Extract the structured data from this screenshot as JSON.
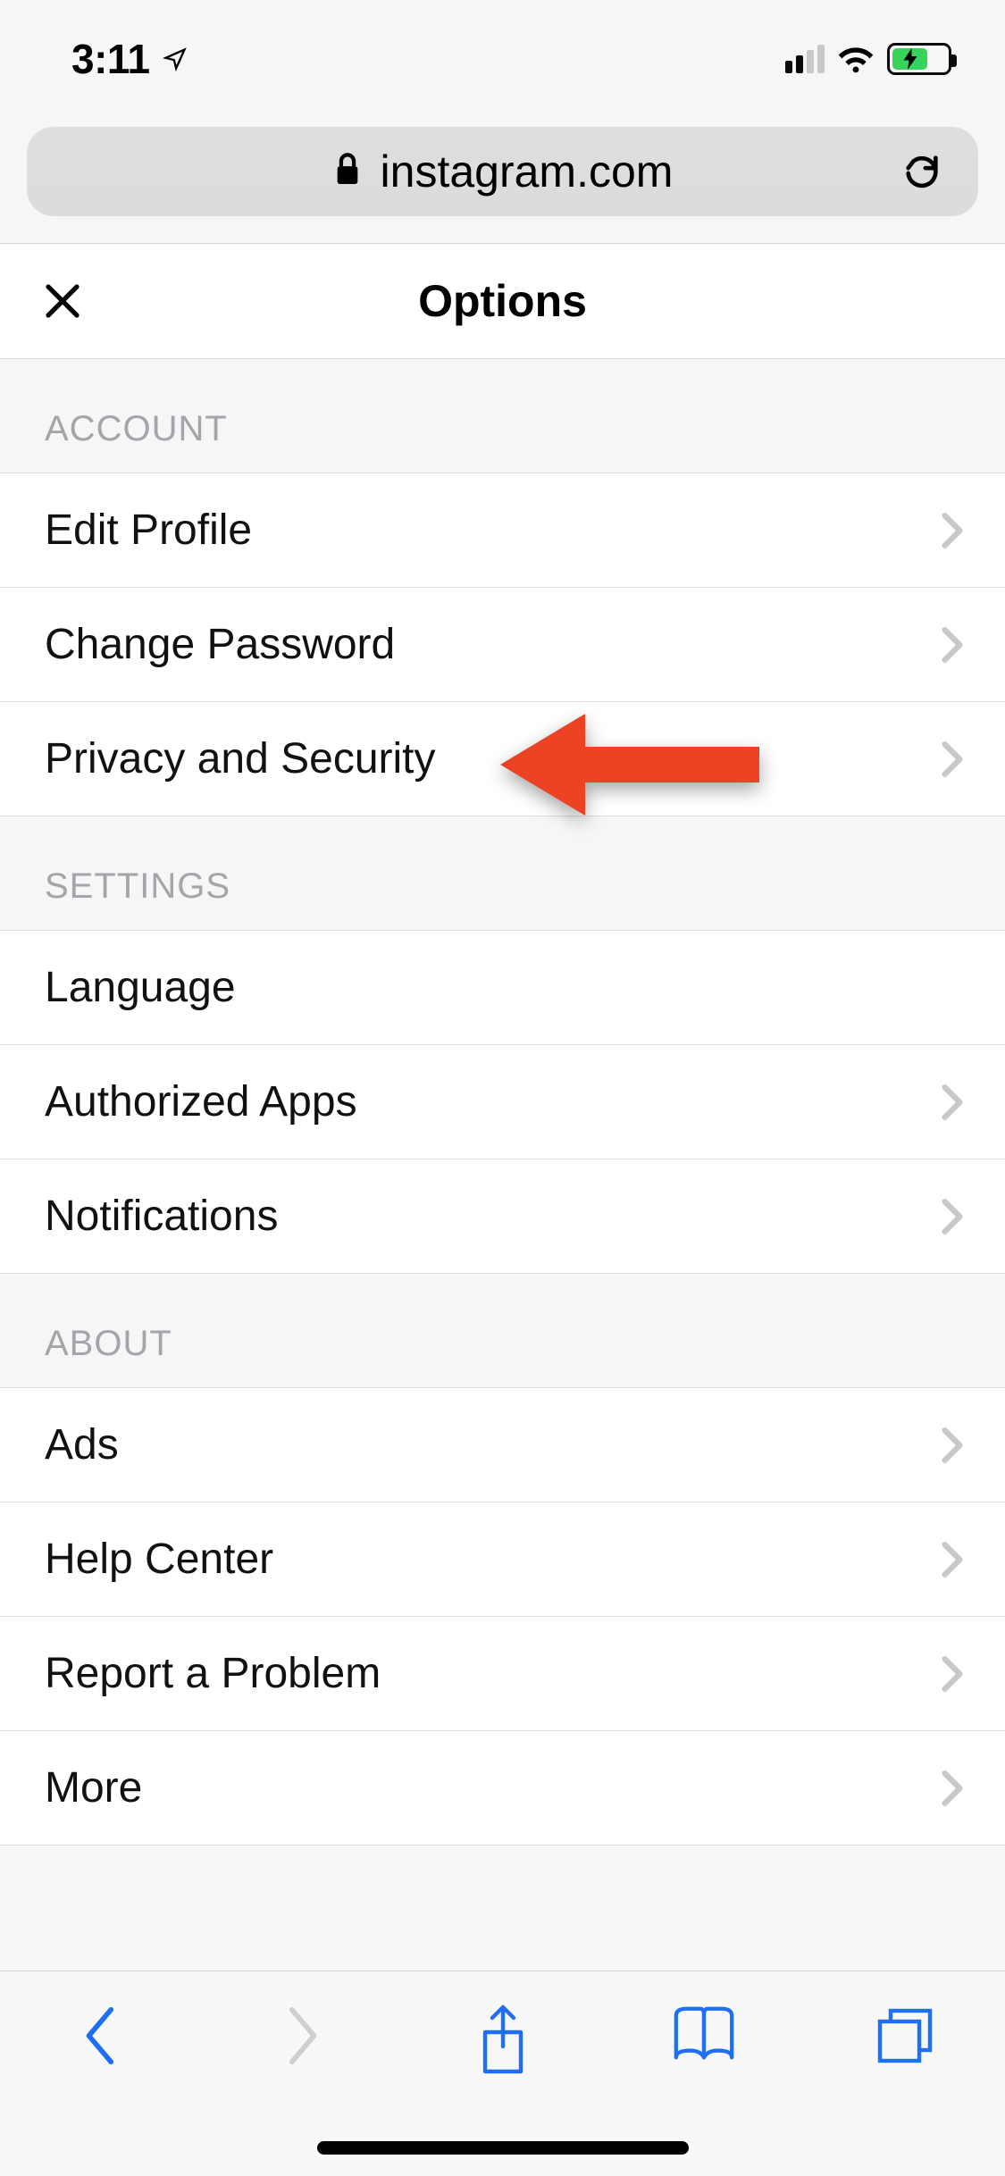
{
  "status": {
    "time": "3:11"
  },
  "address": {
    "domain": "instagram.com"
  },
  "header": {
    "title": "Options"
  },
  "sections": {
    "account": {
      "title": "Account",
      "items": {
        "edit_profile": "Edit Profile",
        "change_password": "Change Password",
        "privacy_security": "Privacy and Security"
      }
    },
    "settings": {
      "title": "Settings",
      "items": {
        "language": "Language",
        "authorized_apps": "Authorized Apps",
        "notifications": "Notifications"
      }
    },
    "about": {
      "title": "About",
      "items": {
        "ads": "Ads",
        "help_center": "Help Center",
        "report_problem": "Report a Problem",
        "more": "More"
      }
    }
  }
}
